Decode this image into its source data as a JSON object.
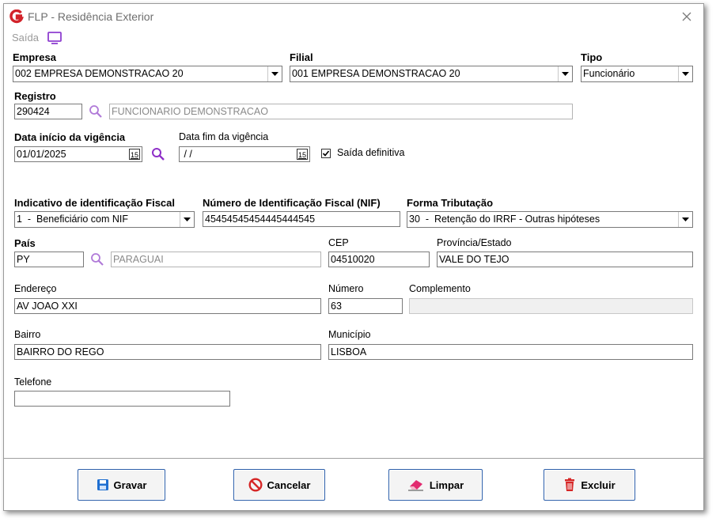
{
  "window": {
    "title": "FLP - Residência Exterior"
  },
  "menu": {
    "saida": "Saída"
  },
  "empresa": {
    "label": "Empresa",
    "value": "002 EMPRESA DEMONSTRACAO 20"
  },
  "filial": {
    "label": "Filial",
    "value": "001 EMPRESA DEMONSTRACAO 20"
  },
  "tipo": {
    "label": "Tipo",
    "value": "Funcionário"
  },
  "registro": {
    "label": "Registro",
    "value": "290424",
    "name": "FUNCIONARIO DEMONSTRACAO"
  },
  "data_inicio": {
    "label": "Data início da vigência",
    "value": "01/01/2025"
  },
  "data_fim": {
    "label": "Data fim da vigência",
    "value": " / /"
  },
  "saida_definitiva": {
    "label": "Saída definitiva",
    "checked": true
  },
  "indicativo": {
    "label": "Indicativo de identificação Fiscal",
    "value": "1  -  Beneficiário com NIF"
  },
  "nif": {
    "label": "Número de Identificação Fiscal (NIF)",
    "value": "45454545454445444545"
  },
  "forma_tributacao": {
    "label": "Forma Tributação",
    "value": "30  -  Retenção do IRRF - Outras hipóteses"
  },
  "pais": {
    "label": "País",
    "code": "PY",
    "name": "PARAGUAI"
  },
  "cep": {
    "label": "CEP",
    "value": "04510020"
  },
  "provincia": {
    "label": "Província/Estado",
    "value": "VALE DO TEJO"
  },
  "endereco": {
    "label": "Endereço",
    "value": "AV JOAO XXI"
  },
  "numero": {
    "label": "Número",
    "value": "63"
  },
  "complemento": {
    "label": "Complemento",
    "value": ""
  },
  "bairro": {
    "label": "Bairro",
    "value": "BAIRRO DO REGO"
  },
  "municipio": {
    "label": "Município",
    "value": "LISBOA"
  },
  "telefone": {
    "label": "Telefone",
    "value": ""
  },
  "buttons": {
    "gravar": "Gravar",
    "cancelar": "Cancelar",
    "limpar": "Limpar",
    "excluir": "Excluir"
  },
  "date_button_glyph": "15",
  "colors": {
    "accent": "#2d5faa",
    "logo": "#d2232a",
    "search": "#a64ac9",
    "save": "#1f6fd1",
    "cancel": "#d62626"
  }
}
